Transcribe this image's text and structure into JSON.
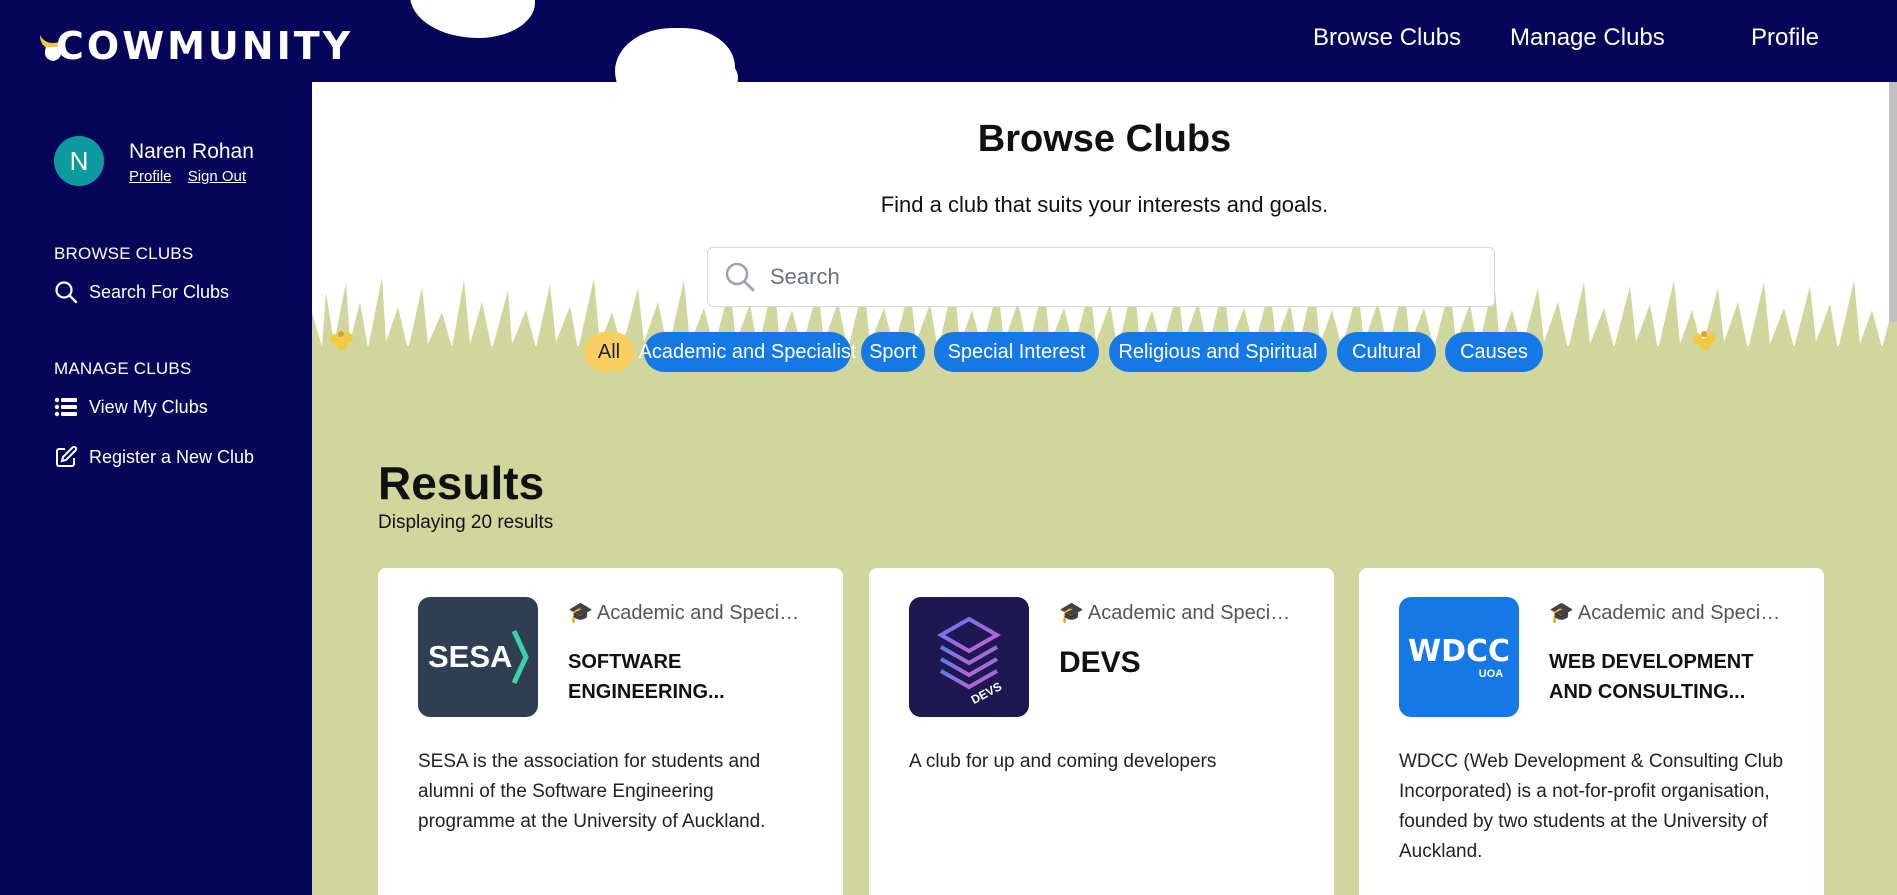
{
  "brand": {
    "name": "COWMUNITY"
  },
  "topnav": [
    {
      "label": "Browse Clubs"
    },
    {
      "label": "Manage Clubs"
    },
    {
      "label": "Profile"
    }
  ],
  "user": {
    "initial": "N",
    "name": "Naren Rohan",
    "profile_link": "Profile",
    "signout_link": "Sign Out"
  },
  "sidebar": {
    "browse_heading": "BROWSE CLUBS",
    "search_item": "Search For Clubs",
    "manage_heading": "MANAGE CLUBS",
    "view_item": "View My Clubs",
    "register_item": "Register a New Club"
  },
  "main": {
    "title": "Browse Clubs",
    "subtitle": "Find a club that suits your interests and goals.",
    "search_placeholder": "Search"
  },
  "filters": [
    {
      "label": "All",
      "active": true
    },
    {
      "label": "Academic and Specialist",
      "active": false
    },
    {
      "label": "Sport",
      "active": false
    },
    {
      "label": "Special Interest",
      "active": false
    },
    {
      "label": "Religious and Spiritual",
      "active": false
    },
    {
      "label": "Cultural",
      "active": false
    },
    {
      "label": "Causes",
      "active": false
    }
  ],
  "results": {
    "title": "Results",
    "count_text": "Displaying 20 results"
  },
  "clubs": [
    {
      "category": "Academic and Specialist",
      "name": "SOFTWARE ENGINEERING...",
      "description": "SESA is the association for students and alumni of the Software Engineering programme at the University of Auckland.",
      "logo_text": "SESA",
      "logo_bg": "#2f3e53"
    },
    {
      "category": "Academic and Specialist",
      "name": "DEVS",
      "description": "A club for up and coming developers",
      "logo_text": "DEVS",
      "logo_bg": "#1e1852"
    },
    {
      "category": "Academic and Specialist",
      "name": "WEB DEVELOPMENT AND CONSULTING...",
      "description": "WDCC (Web Development & Consulting Club Incorporated) is a not-for-profit organisation, founded by two students at the University of Auckland.",
      "logo_text": "WDCC",
      "logo_subtext": "UOA",
      "logo_bg": "#1479e6"
    }
  ],
  "colors": {
    "navy": "#05065a",
    "chip_blue": "#1479e6",
    "chip_active": "#f9cf63",
    "grass": "#d1d79c",
    "avatar": "#0e9ba0"
  }
}
